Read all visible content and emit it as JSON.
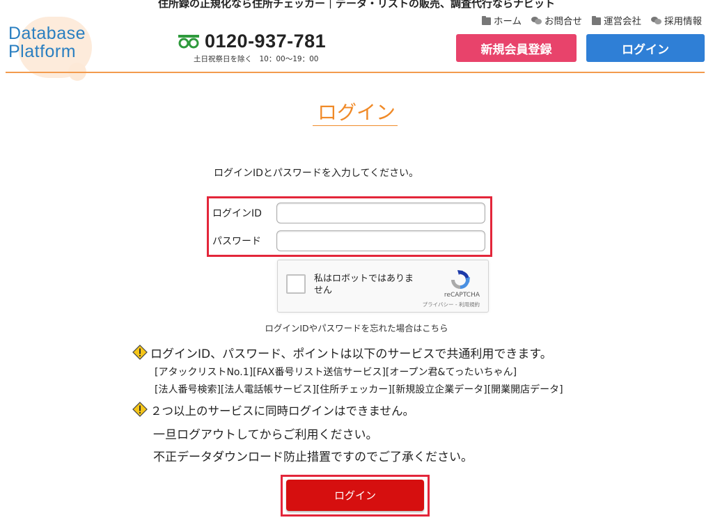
{
  "header": {
    "tagline": "住所録の正規化なら住所チェッカー｜データ・リストの販売、調査代行ならナビット",
    "logo_line1": "Database",
    "logo_line2": "Platform",
    "phone_number": "0120-937-781",
    "phone_hours": "土日祝祭日を除く　10：00～19：00",
    "nav": [
      {
        "label": "ホーム",
        "icon": "folder-icon"
      },
      {
        "label": "お問合せ",
        "icon": "chat-icon"
      },
      {
        "label": "運営会社",
        "icon": "folder-icon"
      },
      {
        "label": "採用情報",
        "icon": "chat-icon"
      }
    ],
    "register_label": "新規会員登録",
    "login_label": "ログイン",
    "colors": {
      "accent": "#f08a28",
      "register": "#e8436b",
      "login": "#2f7fd6",
      "logo": "#2a7fc1"
    }
  },
  "main": {
    "title": "ログイン",
    "instruction": "ログインIDとパスワードを入力してください。",
    "form": {
      "id_label": "ログインID",
      "id_value": "",
      "password_label": "パスワード",
      "password_value": ""
    },
    "captcha": {
      "text": "私はロボットではありません",
      "brand": "reCAPTCHA",
      "terms": "プライバシー - 利用規約"
    },
    "forgot": "ログインIDやパスワードを忘れた場合はこちら",
    "notice1": "ログインID、パスワード、ポイントは以下のサービスで共通利用できます。",
    "services1": "[アタックリストNo.1][FAX番号リスト送信サービス][オープン君&てったいちゃん]",
    "services2": "[法人番号検索][法人電話帳サービス][住所チェッカー][新規設立企業データ][開業開店データ]",
    "notice2": "２つ以上のサービスに同時ログインはできません。",
    "notice2_line2": "一旦ログアウトしてからご利用ください。",
    "notice2_line3": "不正データダウンロード防止措置ですのでご了承ください。",
    "submit_label": "ログイン",
    "colors": {
      "highlight_border": "#e3263a",
      "submit": "#d60f0f",
      "warning": "#f5c518"
    }
  }
}
